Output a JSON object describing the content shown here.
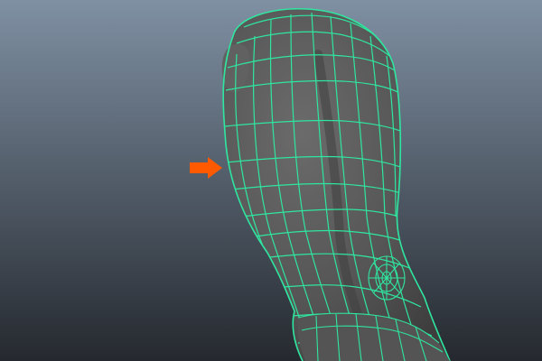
{
  "viewport": {
    "background_top": "#7f90a3",
    "background_bottom": "#25292f",
    "wireframe_color": "#2fe6a0",
    "mesh_color": "#5a5a5a",
    "arrow_color": "#ff5a00",
    "icons": [
      "arrow-right-icon"
    ]
  }
}
